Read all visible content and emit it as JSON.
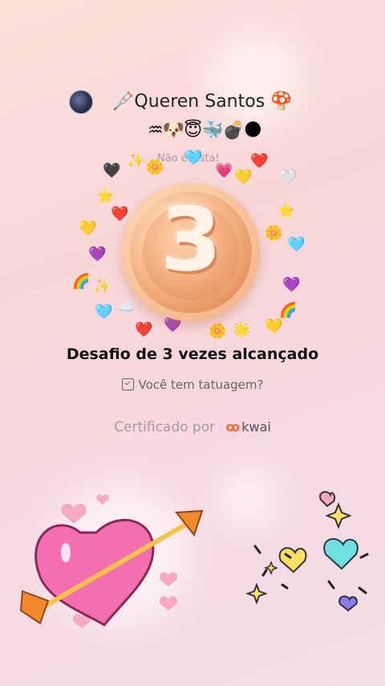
{
  "profile": {
    "username": "Queren Santos",
    "name_prefix_emoji": "🩼",
    "name_suffix_emoji": "🍄",
    "emoji_bio": "♒🐶😇🐳💣🌑",
    "caption": "Não é cista!"
  },
  "challenge": {
    "badge_number": "3",
    "title": "Desafio de 3 vezes alcançado"
  },
  "question": {
    "text": "Você tem tatuagem?",
    "icon": "calendar-check-icon"
  },
  "certificate": {
    "prefix": "Certificado por",
    "brand": "kwai",
    "brand_icon": "kwai-logo-icon"
  },
  "colors": {
    "background": "#f8d6d8",
    "medal": "#f0a575",
    "brand": "#ff6a2b"
  },
  "decorations": {
    "hearts": [
      "💗",
      "💛",
      "💜",
      "🩵",
      "❤️",
      "🤍",
      "🧡",
      "💖"
    ],
    "stars": [
      "✨",
      "⭐",
      "🌟"
    ],
    "other": [
      "🌈",
      "🌼",
      "☁️"
    ]
  }
}
